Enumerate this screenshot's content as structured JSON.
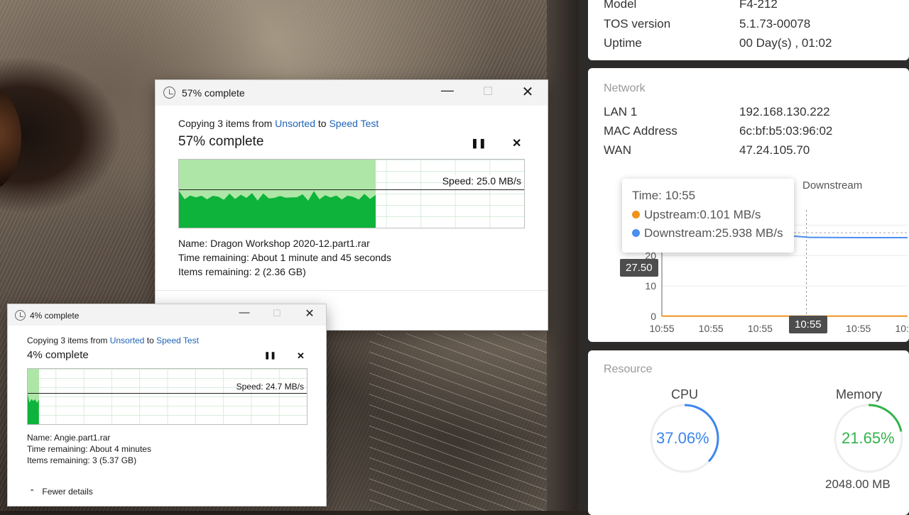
{
  "nas": {
    "device": [
      {
        "label": "Model",
        "value": "F4-212"
      },
      {
        "label": "TOS version",
        "value": "5.1.73-00078"
      },
      {
        "label": "Uptime",
        "value": "00 Day(s) , 01:02"
      }
    ],
    "network": {
      "title": "Network",
      "rows": [
        {
          "label": "LAN 1",
          "value": "192.168.130.222"
        },
        {
          "label": "MAC Address",
          "value": "6c:bf:b5:03:96:02"
        },
        {
          "label": "WAN",
          "value": "47.24.105.70"
        }
      ],
      "legend_downstream": "Downstream",
      "tooltip": {
        "time": "Time: 10:55",
        "upstream": "Upstream:0.101 MB/s",
        "downstream": "Downstream:25.938 MB/s"
      },
      "y_badge": "27.50",
      "x_badge": "10:55",
      "colors": {
        "upstream": "#f0921c",
        "downstream": "#4b8ff0"
      }
    },
    "resource": {
      "title": "Resource",
      "cpu": {
        "label": "CPU",
        "value": "37.06%",
        "fraction": 0.3706,
        "color": "#3d86ee"
      },
      "memory": {
        "label": "Memory",
        "value": "21.65%",
        "fraction": 0.2165,
        "total": "2048.00 MB",
        "color": "#32b34a"
      }
    }
  },
  "chart_data": {
    "type": "line",
    "x": [
      "10:55",
      "10:55",
      "10:55",
      "10:55",
      "10:55",
      "10:55"
    ],
    "yticks": [
      0,
      10,
      20
    ],
    "ylim": [
      0,
      35
    ],
    "series": [
      {
        "name": "Upstream",
        "values": [
          0.1,
          0.1,
          0.1,
          0.1,
          0.1,
          0.1
        ],
        "color": "#f0921c"
      },
      {
        "name": "Downstream",
        "values": [
          27.5,
          27.5,
          27.3,
          26.0,
          25.9,
          25.9
        ],
        "color": "#4b8ff0"
      }
    ]
  },
  "dialog_large": {
    "title": "57% complete",
    "copy_prefix": "Copying 3 items from ",
    "source": "Unsorted",
    "copy_mid": " to ",
    "dest": "Speed Test",
    "heading": "57% complete",
    "progress": 0.57,
    "speed": "Speed: 25.0 MB/s",
    "name": "Name:  Dragon Workshop 2020-12.part1.rar",
    "time": "Time remaining:  About 1 minute and 45 seconds",
    "items": "Items remaining:  2 (2.36 GB)"
  },
  "dialog_small": {
    "title": "4% complete",
    "copy_prefix": "Copying 3 items from ",
    "source": "Unsorted",
    "copy_mid": " to ",
    "dest": "Speed Test",
    "heading": "4% complete",
    "progress": 0.04,
    "speed": "Speed: 24.7 MB/s",
    "name": "Name:  Angie.part1.rar",
    "time": "Time remaining:  About 4 minutes",
    "items": "Items remaining:  3 (5.37 GB)",
    "fewer": "Fewer details"
  },
  "icons": {
    "minimize": "minimize-icon",
    "maximize": "maximize-icon",
    "close": "close-icon",
    "pause": "pause-icon"
  }
}
